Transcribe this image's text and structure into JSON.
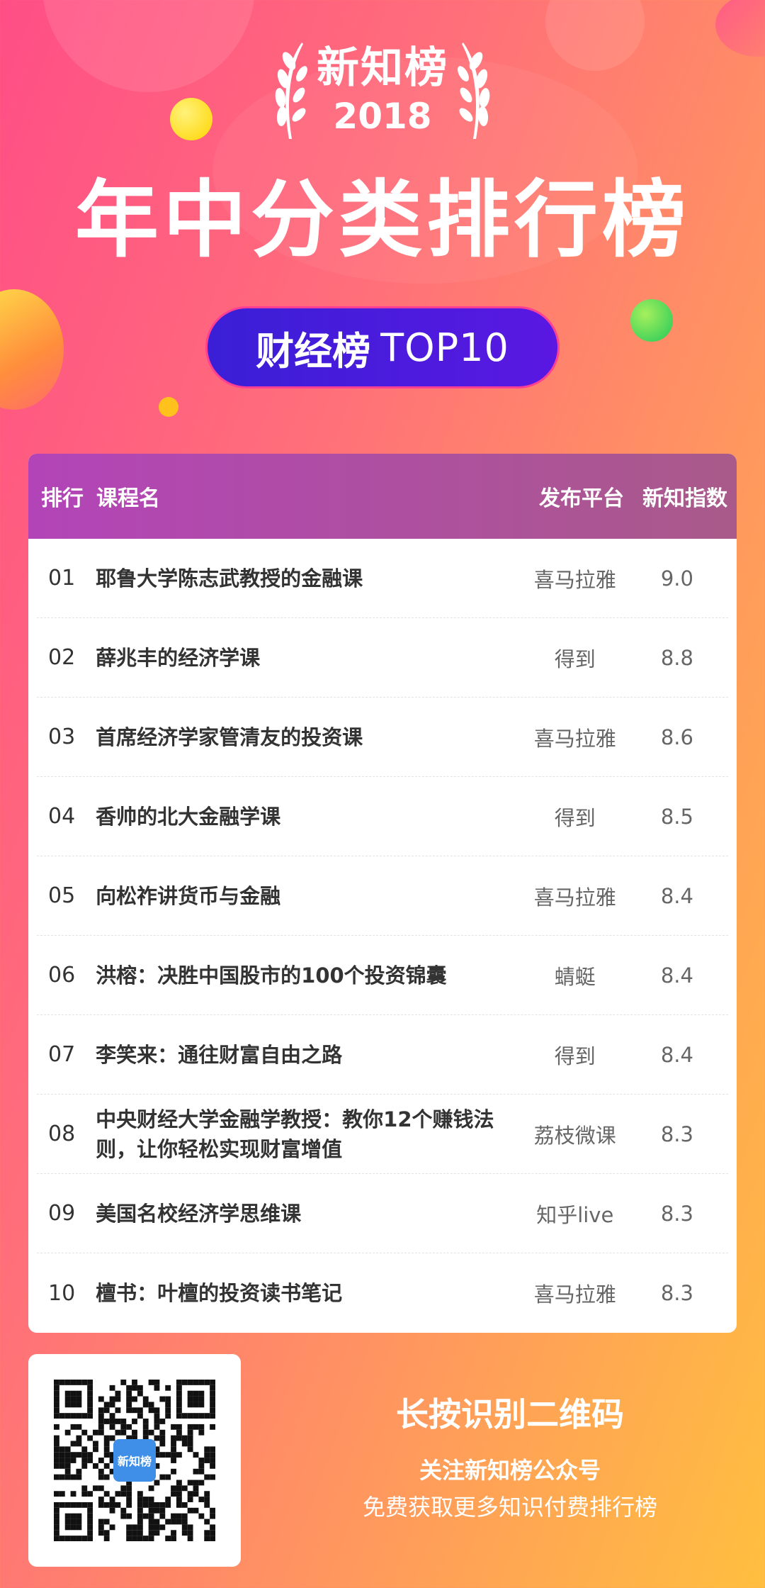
{
  "header": {
    "brand_name": "新知榜",
    "brand_year": "2018",
    "headline": "年中分类排行榜",
    "pill_bold": "财经榜",
    "pill_light": "TOP10"
  },
  "colors": {
    "accent_pill": "#3a1fd6",
    "pill_border": "#ff3f93",
    "table_header_start": "#b344b8",
    "table_header_end": "#a95a8a"
  },
  "table": {
    "headers": {
      "rank": "排行",
      "name": "课程名",
      "platform": "发布平台",
      "score": "新知指数"
    },
    "rows": [
      {
        "rank": "01",
        "name": "耶鲁大学陈志武教授的金融课",
        "platform": "喜马拉雅",
        "score": "9.0"
      },
      {
        "rank": "02",
        "name": "薛兆丰的经济学课",
        "platform": "得到",
        "score": "8.8"
      },
      {
        "rank": "03",
        "name": "首席经济学家管清友的投资课",
        "platform": "喜马拉雅",
        "score": "8.6"
      },
      {
        "rank": "04",
        "name": "香帅的北大金融学课",
        "platform": "得到",
        "score": "8.5"
      },
      {
        "rank": "05",
        "name": "向松祚讲货币与金融",
        "platform": "喜马拉雅",
        "score": "8.4"
      },
      {
        "rank": "06",
        "name": "洪榕：决胜中国股市的100个投资锦囊",
        "platform": "蜻蜓",
        "score": "8.4"
      },
      {
        "rank": "07",
        "name": "李笑来：通往财富自由之路",
        "platform": "得到",
        "score": "8.4"
      },
      {
        "rank": "08",
        "name": "中央财经大学金融学教授：教你12个赚钱法则，让你轻松实现财富增值",
        "platform": "荔枝微课",
        "score": "8.3"
      },
      {
        "rank": "09",
        "name": "美国名校经济学思维课",
        "platform": "知乎live",
        "score": "8.3"
      },
      {
        "rank": "10",
        "name": "檀书：叶檀的投资读书笔记",
        "platform": "喜马拉雅",
        "score": "8.3"
      }
    ]
  },
  "footer": {
    "qr_logo": "新知榜",
    "cta_title": "长按识别二维码",
    "cta_line1": "关注新知榜公众号",
    "cta_line2": "免费获取更多知识付费排行榜"
  }
}
